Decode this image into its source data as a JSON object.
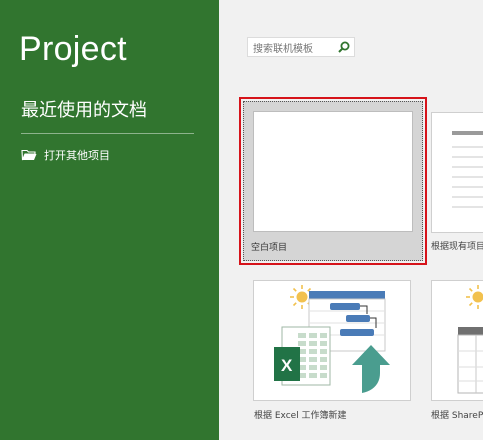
{
  "sidebar": {
    "app_title": "Project",
    "recent_title": "最近使用的文档",
    "open_other_label": "打开其他项目"
  },
  "search": {
    "placeholder": "搜索联机模板"
  },
  "templates": [
    {
      "caption": "空白项目",
      "selected": true
    },
    {
      "caption": "根据现有项目"
    },
    {
      "caption": "根据 Excel 工作簿新建"
    },
    {
      "caption": "根据 ShareP"
    }
  ],
  "colors": {
    "sidebar_bg": "#31752f",
    "selection_border": "#d6131a",
    "search_icon": "#31752f",
    "excel_green": "#217346",
    "gantt_blue": "#4a7bb7",
    "sun_yellow": "#f2c14e"
  }
}
